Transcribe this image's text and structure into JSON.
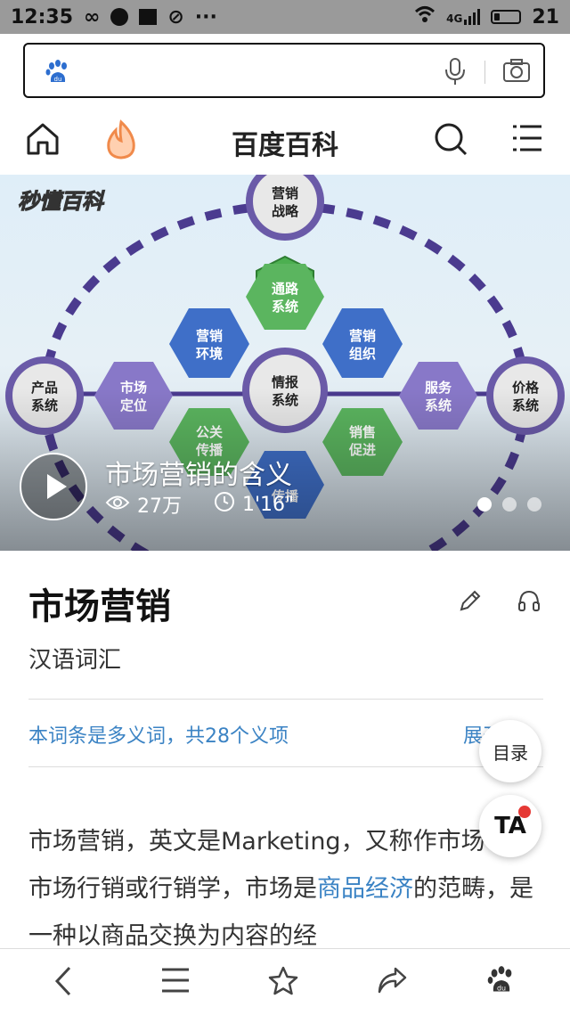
{
  "status_bar": {
    "time": "12:35",
    "signal_label": "4G",
    "battery": "21"
  },
  "search": {
    "placeholder": ""
  },
  "nav": {
    "title": "百度百科"
  },
  "hero": {
    "watermark": "秒懂百科",
    "diagram_nodes": {
      "top": "营销\n战略",
      "left": "产品\n系统",
      "right": "价格\n系统",
      "center": "情报\n系统",
      "hex_top": "通路\n系统",
      "hex_tl": "营销\n环境",
      "hex_tr": "营销\n组织",
      "hex_l": "市场\n定位",
      "hex_r": "服务\n系统",
      "hex_bl": "公关\n传播",
      "hex_br": "销售\n促进",
      "hex_b": "广告\n传播"
    },
    "video_title": "市场营销的含义",
    "views": "27万",
    "duration": "1'16\""
  },
  "article": {
    "title": "市场营销",
    "subtitle": "汉语词汇",
    "polysemy": "本词条是多义词，共28个义项",
    "expand": "展开",
    "body_pre": "市场营销，英文是Marketing，又称作市场学、市场行销或行销学，市场是",
    "body_link": "商品经济",
    "body_post": "的范畴，是一种以商品交换为内容的经"
  },
  "floating": {
    "toc": "目录",
    "ta": "TA"
  },
  "colors": {
    "link": "#3b83c4",
    "diagram_purple": "#4b3b8f",
    "hex_blue": "#3f6fc8",
    "hex_green": "#4caf50",
    "hex_violet": "#8878c8"
  }
}
